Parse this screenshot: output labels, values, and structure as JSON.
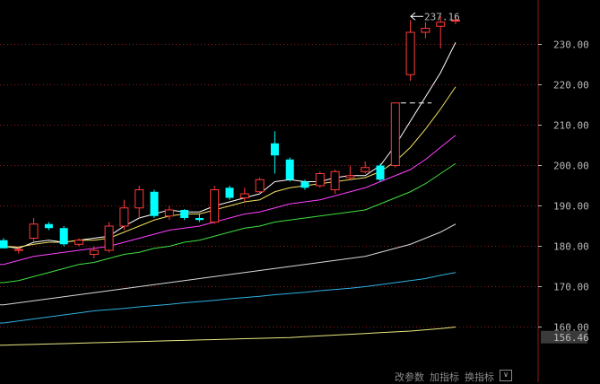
{
  "chart_data": {
    "type": "candlestick",
    "ylim": [
      155,
      240
    ],
    "y_ticks": [
      {
        "value": 230,
        "label": "230.00"
      },
      {
        "value": 220,
        "label": "220.00"
      },
      {
        "value": 210,
        "label": "210.00"
      },
      {
        "value": 200,
        "label": "200.00"
      },
      {
        "value": 190,
        "label": "190.00"
      },
      {
        "value": 180,
        "label": "180.00"
      },
      {
        "value": 170,
        "label": "170.00"
      },
      {
        "value": 160,
        "label": "160.00"
      }
    ],
    "current_price_label": "156.46",
    "high_annotation": "237.16",
    "high_value": 237.16,
    "candles": [
      {
        "o": 181.5,
        "h": 182.0,
        "l": 179.5,
        "c": 179.5
      },
      {
        "o": 179.0,
        "h": 179.8,
        "l": 178.2,
        "c": 179.2
      },
      {
        "o": 182.0,
        "h": 187.0,
        "l": 181.0,
        "c": 185.5
      },
      {
        "o": 185.5,
        "h": 186.0,
        "l": 184.0,
        "c": 184.5
      },
      {
        "o": 184.5,
        "h": 185.0,
        "l": 180.0,
        "c": 180.5
      },
      {
        "o": 180.5,
        "h": 182.0,
        "l": 180.0,
        "c": 181.5
      },
      {
        "o": 178.0,
        "h": 180.0,
        "l": 177.0,
        "c": 179.0
      },
      {
        "o": 179.0,
        "h": 186.0,
        "l": 178.5,
        "c": 185.0
      },
      {
        "o": 185.0,
        "h": 191.5,
        "l": 184.0,
        "c": 189.5
      },
      {
        "o": 189.5,
        "h": 195.0,
        "l": 187.0,
        "c": 194.0
      },
      {
        "o": 193.5,
        "h": 194.0,
        "l": 187.0,
        "c": 187.5
      },
      {
        "o": 187.5,
        "h": 190.0,
        "l": 186.5,
        "c": 189.0
      },
      {
        "o": 189.0,
        "h": 189.2,
        "l": 186.5,
        "c": 187.0
      },
      {
        "o": 187.0,
        "h": 188.0,
        "l": 186.0,
        "c": 186.5
      },
      {
        "o": 186.0,
        "h": 195.0,
        "l": 185.5,
        "c": 194.0
      },
      {
        "o": 194.5,
        "h": 195.0,
        "l": 191.5,
        "c": 192.0
      },
      {
        "o": 192.0,
        "h": 194.5,
        "l": 191.0,
        "c": 193.0
      },
      {
        "o": 193.5,
        "h": 197.0,
        "l": 193.0,
        "c": 196.5
      },
      {
        "o": 205.5,
        "h": 208.5,
        "l": 198.0,
        "c": 202.5
      },
      {
        "o": 201.5,
        "h": 202.0,
        "l": 196.0,
        "c": 196.5
      },
      {
        "o": 196.0,
        "h": 196.5,
        "l": 194.0,
        "c": 194.5
      },
      {
        "o": 195.0,
        "h": 198.5,
        "l": 194.5,
        "c": 198.0
      },
      {
        "o": 194.0,
        "h": 199.0,
        "l": 193.0,
        "c": 198.5
      },
      {
        "o": 197.0,
        "h": 200.0,
        "l": 196.5,
        "c": 197.5
      },
      {
        "o": 198.5,
        "h": 201.0,
        "l": 198.0,
        "c": 199.5
      },
      {
        "o": 200.0,
        "h": 200.5,
        "l": 196.0,
        "c": 196.5
      },
      {
        "o": 200.0,
        "h": 215.5,
        "l": 199.5,
        "c": 215.5
      },
      {
        "o": 222.5,
        "h": 236.0,
        "l": 221.0,
        "c": 233.0
      },
      {
        "o": 233.0,
        "h": 235.5,
        "l": 231.5,
        "c": 234.0
      },
      {
        "o": 234.5,
        "h": 237.0,
        "l": 229.0,
        "c": 235.5
      },
      {
        "o": 236.0,
        "h": 237.16,
        "l": 235.0,
        "c": 236.0
      }
    ],
    "ma_series": [
      {
        "color": "#ffffff",
        "values": [
          180.0,
          179.5,
          181.0,
          181.5,
          181.0,
          181.5,
          182.0,
          182.5,
          185.0,
          187.0,
          188.0,
          189.0,
          188.5,
          188.5,
          190.0,
          191.0,
          192.0,
          193.0,
          196.0,
          196.5,
          196.0,
          196.0,
          197.0,
          197.5,
          197.5,
          200.0,
          205.0,
          211.0,
          217.0,
          223.0,
          230.5
        ]
      },
      {
        "color": "#f0e060",
        "values": [
          180.0,
          179.8,
          180.5,
          181.0,
          181.0,
          181.5,
          181.5,
          182.0,
          183.5,
          185.0,
          186.5,
          187.5,
          188.0,
          188.0,
          189.0,
          190.0,
          191.0,
          191.5,
          193.5,
          194.5,
          195.0,
          195.5,
          196.0,
          196.5,
          197.0,
          198.5,
          201.0,
          204.5,
          209.0,
          214.0,
          219.5
        ]
      },
      {
        "color": "#ff40ff",
        "values": [
          175.5,
          176.5,
          177.5,
          178.0,
          178.5,
          179.0,
          179.5,
          180.0,
          181.0,
          182.0,
          183.0,
          184.0,
          184.5,
          185.0,
          186.0,
          187.0,
          188.0,
          188.5,
          189.5,
          190.5,
          191.0,
          191.5,
          192.5,
          193.5,
          194.5,
          196.0,
          197.5,
          199.0,
          201.5,
          204.5,
          207.5
        ]
      },
      {
        "color": "#40e040",
        "values": [
          171.0,
          171.5,
          172.5,
          173.5,
          174.5,
          175.5,
          176.0,
          177.0,
          178.0,
          178.5,
          179.5,
          180.0,
          181.0,
          181.5,
          182.5,
          183.5,
          184.5,
          185.0,
          186.0,
          186.5,
          187.0,
          187.5,
          188.0,
          188.5,
          189.0,
          190.5,
          192.0,
          193.5,
          195.5,
          198.0,
          200.5
        ]
      },
      {
        "color": "#d8d8d8",
        "values": [
          165.5,
          166.0,
          166.5,
          167.0,
          167.5,
          168.0,
          168.5,
          169.0,
          169.5,
          170.0,
          170.5,
          171.0,
          171.5,
          172.0,
          172.5,
          173.0,
          173.5,
          174.0,
          174.5,
          175.0,
          175.5,
          176.0,
          176.5,
          177.0,
          177.5,
          178.5,
          179.5,
          180.5,
          182.0,
          183.5,
          185.5
        ]
      },
      {
        "color": "#30b0e0",
        "values": [
          161.0,
          161.5,
          162.0,
          162.5,
          163.0,
          163.5,
          164.0,
          164.3,
          164.6,
          165.0,
          165.3,
          165.6,
          166.0,
          166.3,
          166.6,
          167.0,
          167.3,
          167.6,
          168.0,
          168.3,
          168.6,
          169.0,
          169.3,
          169.6,
          170.0,
          170.5,
          171.0,
          171.5,
          172.0,
          172.8,
          173.5
        ]
      },
      {
        "color": "#e8e880",
        "values": [
          155.5,
          155.6,
          155.7,
          155.8,
          155.9,
          156.0,
          156.1,
          156.2,
          156.3,
          156.4,
          156.5,
          156.6,
          156.7,
          156.8,
          156.9,
          157.0,
          157.1,
          157.2,
          157.3,
          157.4,
          157.6,
          157.8,
          158.0,
          158.2,
          158.4,
          158.6,
          158.8,
          159.0,
          159.3,
          159.6,
          160.0
        ]
      }
    ]
  },
  "footer": {
    "items": [
      "改参数",
      "加指标",
      "换指标"
    ],
    "box": "∨"
  },
  "colors": {
    "up": "#ff3a3a",
    "down": "#00ffff",
    "grid": "#8a1a1a",
    "axis": "#b8b8b8",
    "price_box_bg": "#3a3a3a"
  }
}
